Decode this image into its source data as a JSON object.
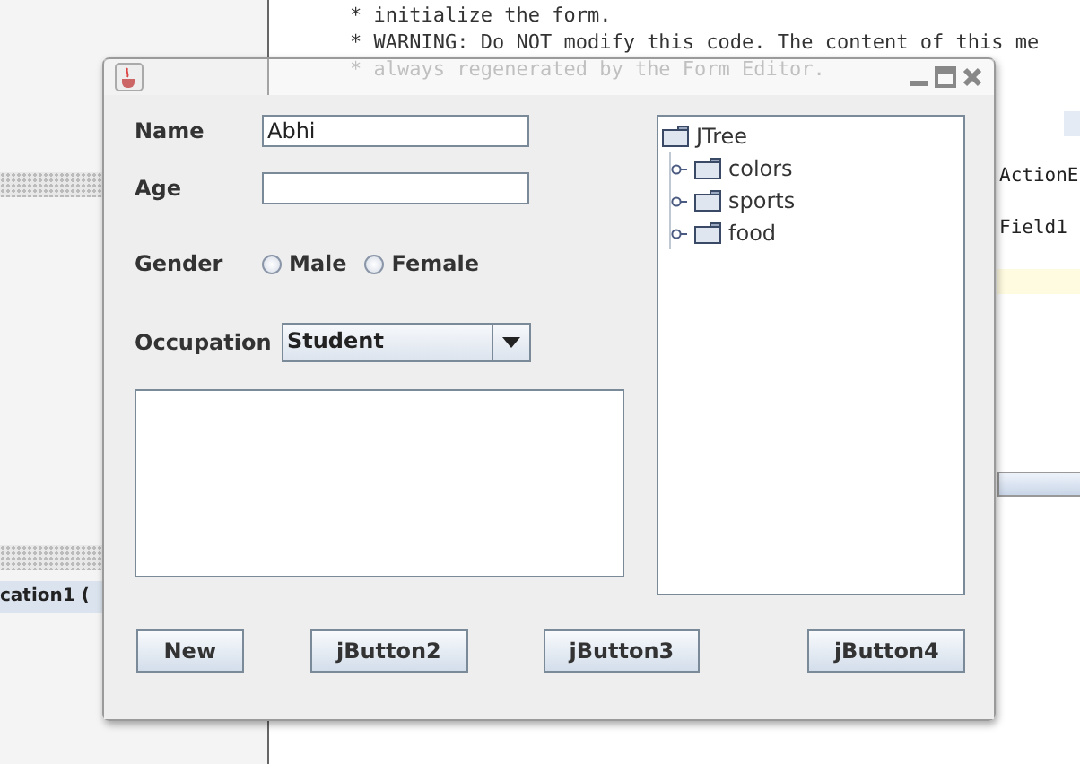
{
  "editor": {
    "code_lines": [
      "* initialize the form.",
      "* WARNING: Do NOT modify this code. The content of this me",
      "* always regenerated by the Form Editor."
    ],
    "side_code": [
      "ActionE",
      "Field1"
    ],
    "output_tab": "cation1 ("
  },
  "dialog": {
    "fields": [
      {
        "label": "Name",
        "value": "Abhi"
      },
      {
        "label": "Age"
      }
    ],
    "gender": {
      "label": "Gender",
      "options": [
        {
          "label": "Male",
          "selected": false
        },
        {
          "label": "Female",
          "selected": false
        }
      ]
    },
    "occupation": {
      "label": "Occupation",
      "value": "Student"
    },
    "tree": {
      "root": "JTree",
      "children": [
        {
          "label": "colors",
          "expanded": false
        },
        {
          "label": "sports",
          "expanded": false
        },
        {
          "label": "food",
          "expanded": false
        }
      ]
    },
    "buttons": [
      "New",
      "jButton2",
      "jButton3",
      "jButton4"
    ]
  }
}
